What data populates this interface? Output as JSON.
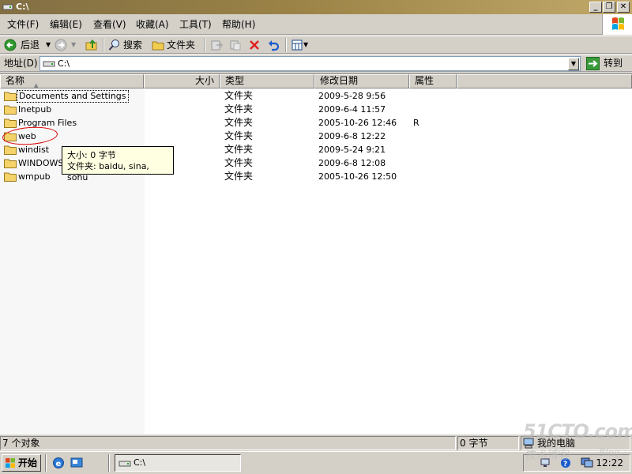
{
  "window": {
    "title": "C:\\"
  },
  "menu": [
    {
      "label": "文件(F)"
    },
    {
      "label": "编辑(E)"
    },
    {
      "label": "查看(V)"
    },
    {
      "label": "收藏(A)"
    },
    {
      "label": "工具(T)"
    },
    {
      "label": "帮助(H)"
    }
  ],
  "toolbar": {
    "back_label": "后退",
    "search_label": "搜索",
    "folders_label": "文件夹"
  },
  "address": {
    "label": "地址(D)",
    "value": "C:\\",
    "go_label": "转到"
  },
  "columns": {
    "name": "名称",
    "size": "大小",
    "type": "类型",
    "modified": "修改日期",
    "attributes": "属性"
  },
  "rows": [
    {
      "name": "Documents and Settings",
      "type": "文件夹",
      "modified": "2009-5-28 9:56",
      "attr": ""
    },
    {
      "name": "Inetpub",
      "type": "文件夹",
      "modified": "2009-6-4 11:57",
      "attr": ""
    },
    {
      "name": "Program Files",
      "type": "文件夹",
      "modified": "2005-10-26 12:46",
      "attr": "R"
    },
    {
      "name": "web",
      "type": "文件夹",
      "modified": "2009-6-8 12:22",
      "attr": ""
    },
    {
      "name": "windist",
      "type": "文件夹",
      "modified": "2009-5-24 9:21",
      "attr": ""
    },
    {
      "name": "WINDOWS",
      "type": "文件夹",
      "modified": "2009-6-8 12:08",
      "attr": ""
    },
    {
      "name": "wmpub",
      "type": "文件夹",
      "modified": "2005-10-26 12:50",
      "attr": ""
    }
  ],
  "tooltip": {
    "line1": "大小: 0 字节",
    "line2": "文件夹: baidu, sina, sohu"
  },
  "status": {
    "count": "7 个对象",
    "size": "0 字节",
    "zone": "我的电脑"
  },
  "taskbar": {
    "start_label": "开始",
    "task_label": "C:\\",
    "clock": "12:22"
  },
  "watermark": {
    "line1": "51CTO.com",
    "line2": "技术博客",
    "line3": "Blog"
  },
  "colors": {
    "titlebar": "#9a8246",
    "tooltip_bg": "#ffffe1",
    "annotation": "#dd0000",
    "face": "#d4d0c8"
  }
}
